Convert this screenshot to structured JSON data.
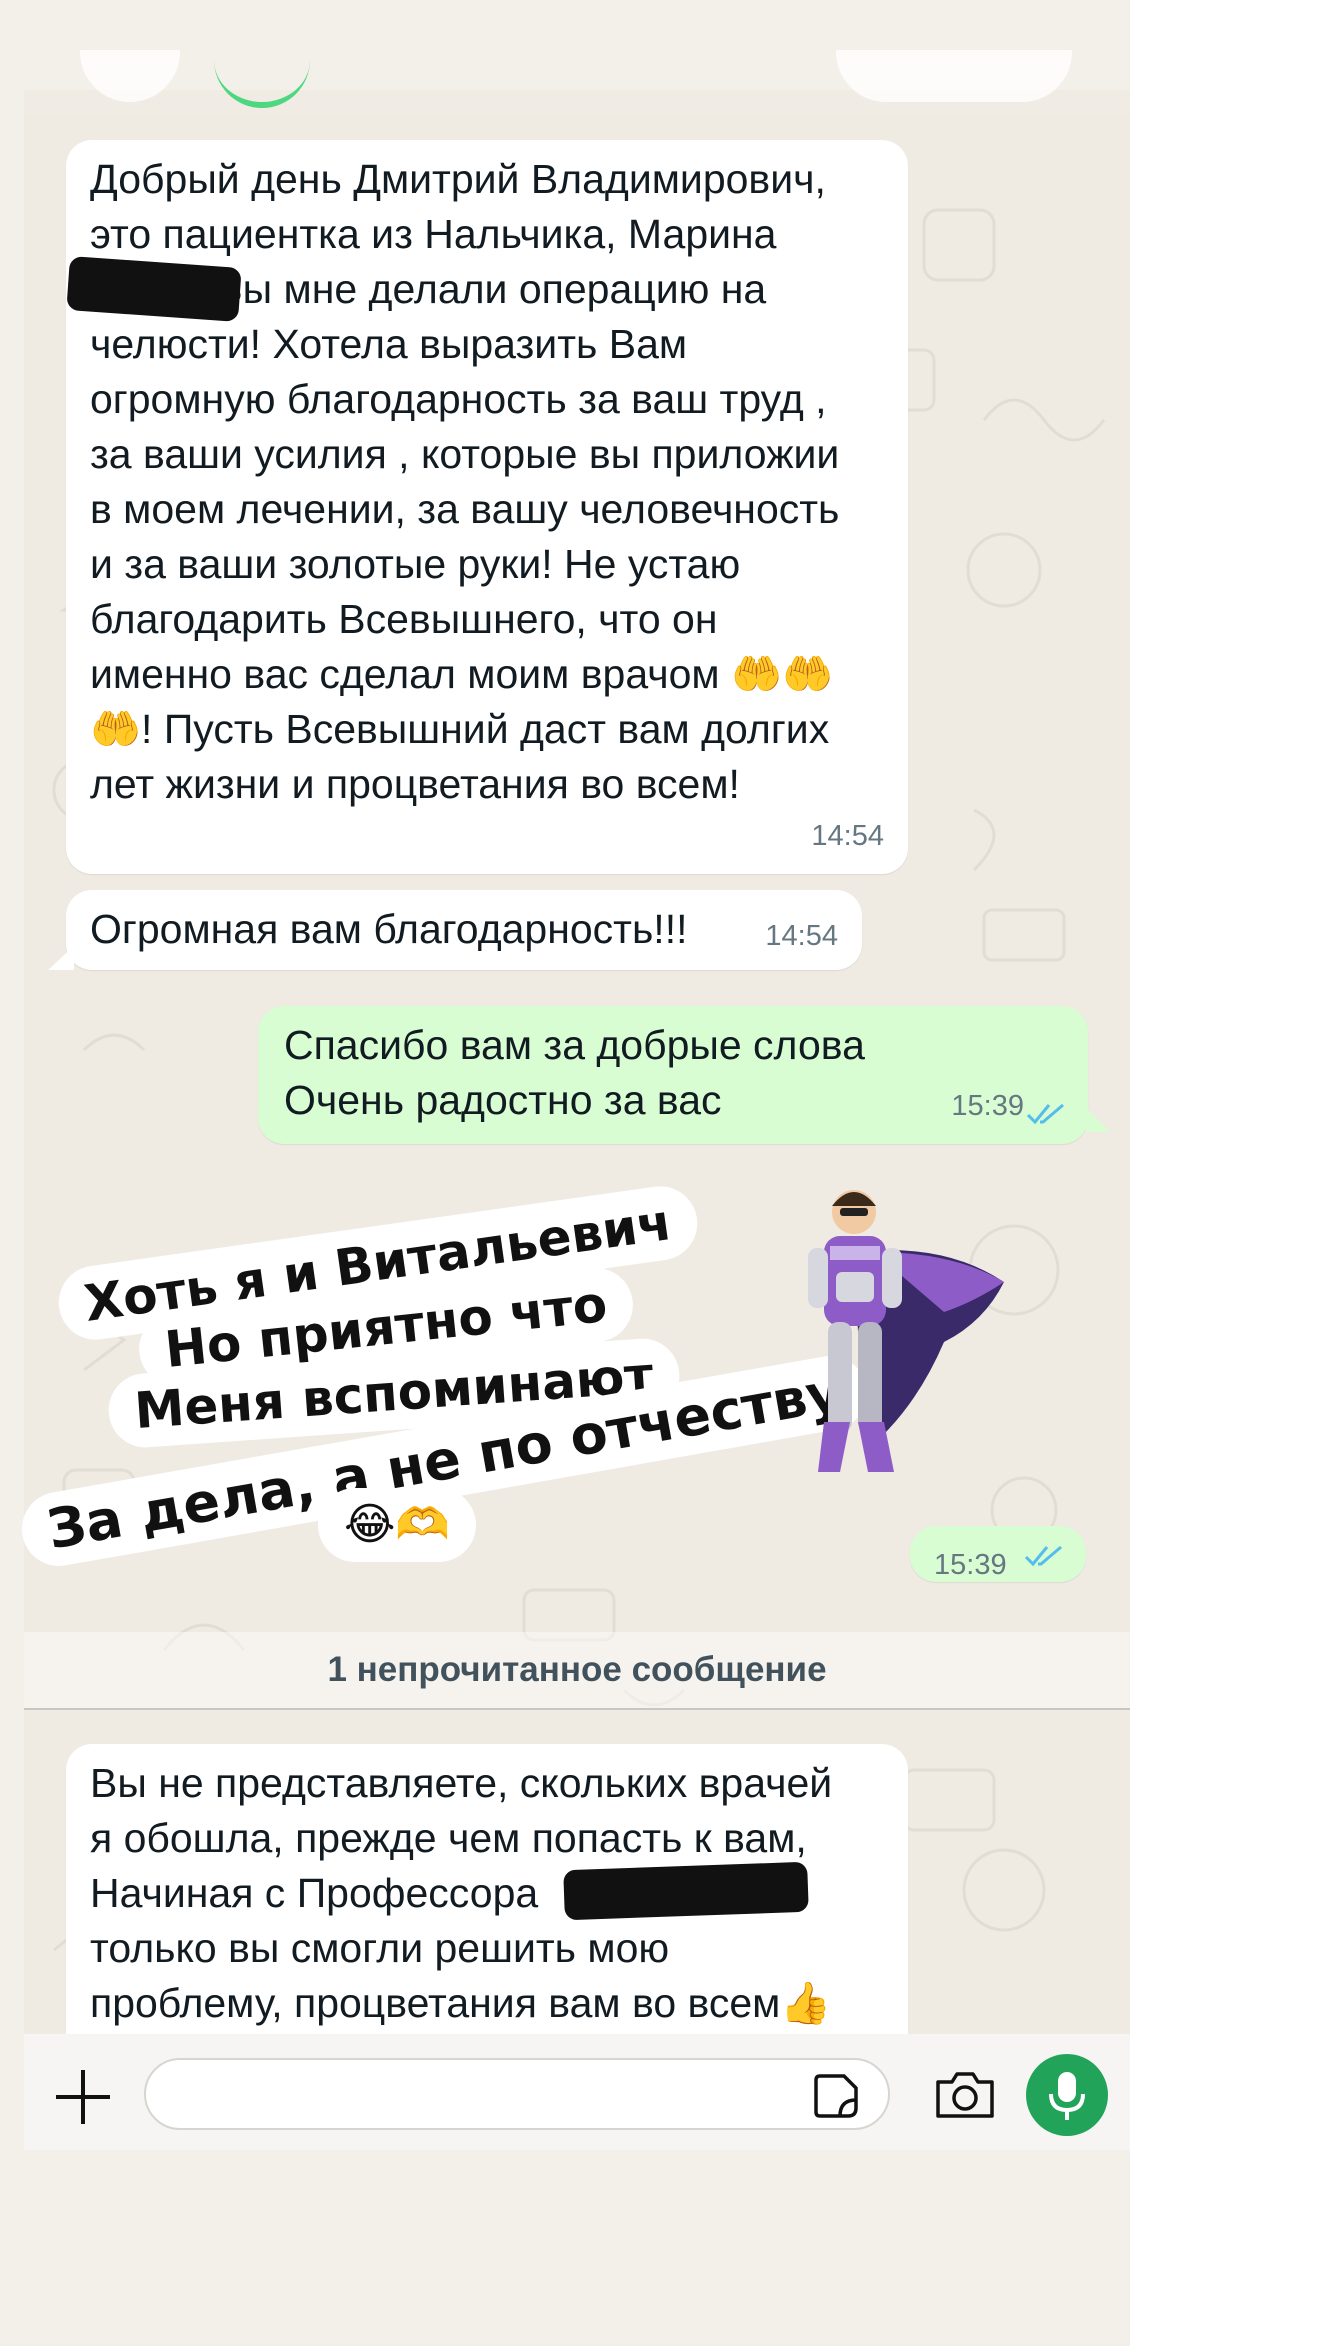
{
  "messages": [
    {
      "direction": "incoming",
      "text": "Добрый день Дмитрий Владимирович,\nэто пациентка из Нальчика, Марина\n         ! Вы мне делали операцию на\nчелюсти! Хотела выразить Вам\nогромную благодарность за ваш труд ,\nза ваши усилия , которые вы приложии\nв моем лечении, за вашу человечность\nи за ваши золотые руки! Не устаю\nблагодарить Всевышнего, что он\nименно вас сделал моим врачом 🤲🤲\n🤲! Пусть Всевышний даст вам долгих\nлет жизни и процветания во всем!",
      "time": "14:54"
    },
    {
      "direction": "incoming",
      "text": "Огромная вам благодарность!!!",
      "time": "14:54"
    },
    {
      "direction": "outgoing",
      "text": "Спасибо вам за добрые слова\nОчень радостно за вас",
      "time": "15:39",
      "status": "read"
    },
    {
      "direction": "outgoing",
      "type": "sticker",
      "sticker_lines": [
        "Хоть я и Витальевич",
        "Но приятно что",
        "Меня вспоминают",
        "За дела, а не по отчеству",
        "😂🫶"
      ],
      "time": "15:39",
      "status": "read"
    },
    {
      "direction": "incoming",
      "text": "Вы не представляете, скольких врачей\nя обошла, прежде чем попасть к вам,\nНачиная с Профессора\nтолько вы смогли решить мою\nпроблему, процветания вам во всем👍"
    }
  ],
  "unread_divider": "1 непрочитанное сообщение",
  "composer": {
    "placeholder": ""
  },
  "icons": {
    "add": "plus-icon",
    "sticker": "sticker-icon",
    "camera": "camera-icon",
    "mic": "microphone-icon",
    "read_receipt": "double-check-icon"
  },
  "colors": {
    "incoming_bubble": "#ffffff",
    "outgoing_bubble": "#d9fdd3",
    "read_tick": "#53bdeb",
    "mic_button": "#21a35a",
    "chat_background": "#efeae2"
  }
}
